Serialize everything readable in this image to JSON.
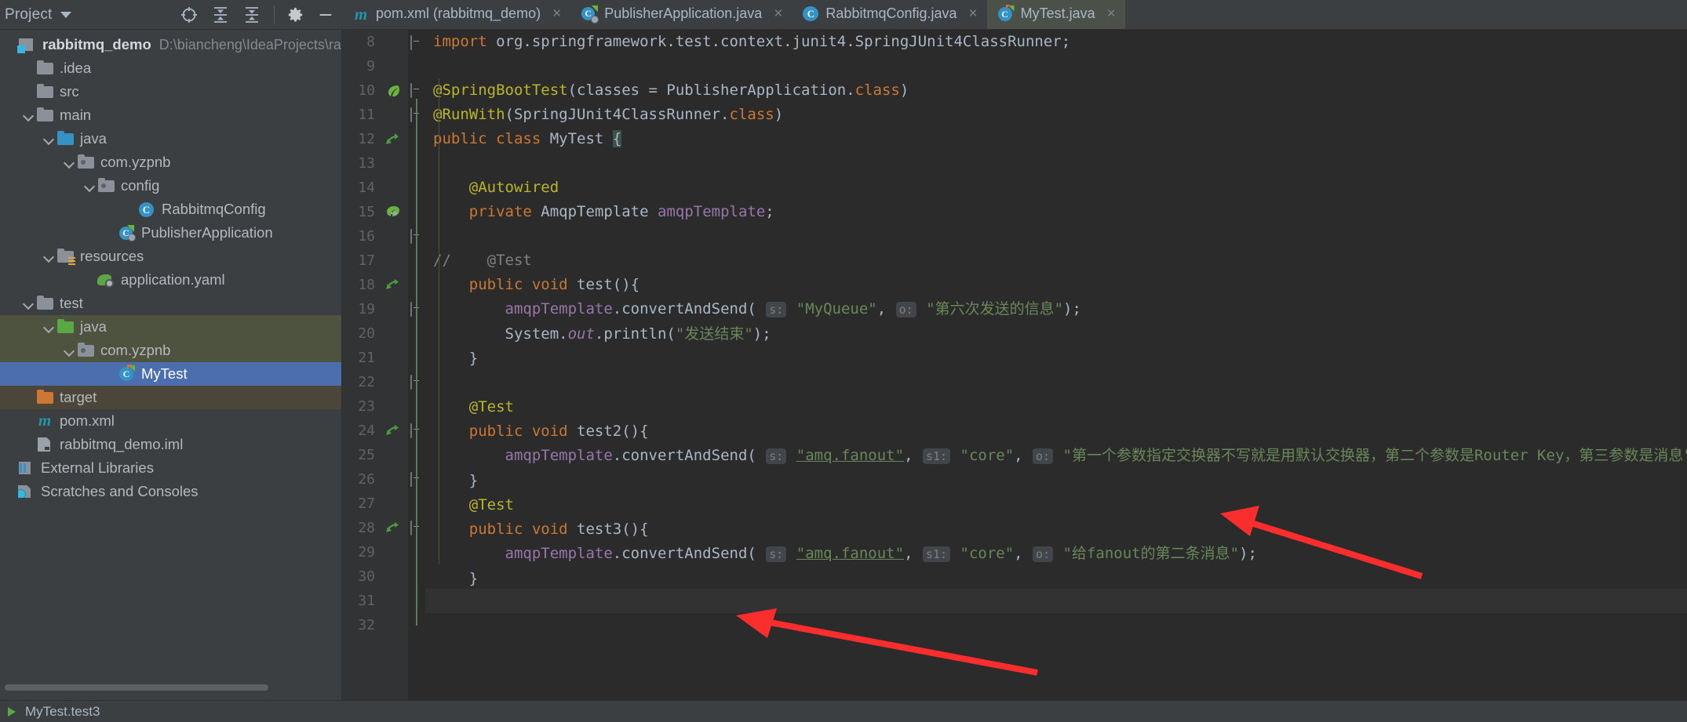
{
  "project_panel": {
    "title": "Project",
    "icons": [
      "locate-icon",
      "expand-all-icon",
      "collapse-all-icon",
      "gear-icon",
      "minimize-icon"
    ],
    "root": {
      "name": "rabbitmq_demo",
      "path": "D:\\biancheng\\IdeaProjects\\rab"
    },
    "items": [
      {
        "label": ".idea",
        "icon": "folder-icon",
        "indent": 1,
        "arrow": "none",
        "state": "normal"
      },
      {
        "label": "src",
        "icon": "folder-icon",
        "indent": 1,
        "arrow": "none",
        "state": "normal"
      },
      {
        "label": "main",
        "icon": "folder-icon",
        "indent": 2,
        "arrow": "open",
        "state": "normal"
      },
      {
        "label": "java",
        "icon": "source-folder-icon",
        "indent": 3,
        "arrow": "open",
        "state": "normal"
      },
      {
        "label": "com.yzpnb",
        "icon": "package-icon",
        "indent": 4,
        "arrow": "open",
        "state": "normal"
      },
      {
        "label": "config",
        "icon": "package-icon",
        "indent": 5,
        "arrow": "open",
        "state": "normal"
      },
      {
        "label": "RabbitmqConfig",
        "icon": "java-class-icon",
        "indent": 6,
        "arrow": "none",
        "state": "normal"
      },
      {
        "label": "PublisherApplication",
        "icon": "spring-boot-class-icon",
        "indent": 5,
        "arrow": "none",
        "state": "normal"
      },
      {
        "label": "resources",
        "icon": "resources-folder-icon",
        "indent": 3,
        "arrow": "open",
        "state": "normal"
      },
      {
        "label": "application.yaml",
        "icon": "spring-yaml-icon",
        "indent": 4,
        "arrow": "none",
        "state": "normal"
      },
      {
        "label": "test",
        "icon": "folder-icon",
        "indent": 2,
        "arrow": "open",
        "state": "normal"
      },
      {
        "label": "java",
        "icon": "test-source-folder-icon",
        "indent": 3,
        "arrow": "open",
        "state": "green"
      },
      {
        "label": "com.yzpnb",
        "icon": "package-icon",
        "indent": 4,
        "arrow": "open",
        "state": "green"
      },
      {
        "label": "MyTest",
        "icon": "java-test-class-icon",
        "indent": 5,
        "arrow": "none",
        "state": "selected"
      },
      {
        "label": "target",
        "icon": "excluded-folder-icon",
        "indent": 1,
        "arrow": "none",
        "state": "brown"
      },
      {
        "label": "pom.xml",
        "icon": "maven-icon",
        "indent": 1,
        "arrow": "none",
        "state": "normal"
      },
      {
        "label": "rabbitmq_demo.iml",
        "icon": "iml-file-icon",
        "indent": 1,
        "arrow": "none",
        "state": "normal"
      },
      {
        "label": "External Libraries",
        "icon": "library-icon",
        "indent": 0,
        "arrow": "none",
        "state": "normal"
      },
      {
        "label": "Scratches and Consoles",
        "icon": "scratches-icon",
        "indent": 0,
        "arrow": "none",
        "state": "normal"
      }
    ]
  },
  "tabs": [
    {
      "label": "pom.xml (rabbitmq_demo)",
      "icon": "maven-icon",
      "active": false,
      "close": "×"
    },
    {
      "label": "PublisherApplication.java",
      "icon": "spring-boot-class-icon",
      "active": false,
      "close": "×"
    },
    {
      "label": "RabbitmqConfig.java",
      "icon": "java-class-icon",
      "active": false,
      "close": "×"
    },
    {
      "label": "MyTest.java",
      "icon": "java-test-class-icon",
      "active": true,
      "close": "×"
    }
  ],
  "editor": {
    "first_line": 8,
    "last_line": 32,
    "caret_line": 31,
    "line_numbers": [
      8,
      9,
      10,
      11,
      12,
      13,
      14,
      15,
      16,
      17,
      18,
      19,
      20,
      21,
      22,
      23,
      24,
      25,
      26,
      27,
      28,
      29,
      30,
      31,
      32
    ],
    "gutter_marks": {
      "10": "spring-leaf-icon",
      "12": "implemented-method-icon",
      "15": "bean-autowired-icon",
      "18": "run-test-icon",
      "24": "run-test-icon",
      "28": "run-test-icon"
    },
    "lines": [
      {
        "n": 8,
        "text": "import org.springframework.test.context.junit4.SpringJUnit4ClassRunner;"
      },
      {
        "n": 9,
        "text": ""
      },
      {
        "n": 10,
        "text": "@SpringBootTest(classes = PublisherApplication.class)"
      },
      {
        "n": 11,
        "text": "@RunWith(SpringJUnit4ClassRunner.class)"
      },
      {
        "n": 12,
        "text": "public class MyTest {"
      },
      {
        "n": 13,
        "text": ""
      },
      {
        "n": 14,
        "text": "    @Autowired"
      },
      {
        "n": 15,
        "text": "    private AmqpTemplate amqpTemplate;"
      },
      {
        "n": 16,
        "text": ""
      },
      {
        "n": 17,
        "text": "//    @Test"
      },
      {
        "n": 18,
        "text": "    public void test(){"
      },
      {
        "n": 19,
        "text": "        amqpTemplate.convertAndSend( s: \"MyQueue\", o: \"第六次发送的信息\");"
      },
      {
        "n": 20,
        "text": "        System.out.println(\"发送结束\");"
      },
      {
        "n": 21,
        "text": "    }"
      },
      {
        "n": 22,
        "text": ""
      },
      {
        "n": 23,
        "text": "    @Test"
      },
      {
        "n": 24,
        "text": "    public void test2(){"
      },
      {
        "n": 25,
        "text": "        amqpTemplate.convertAndSend( s: \"amq.fanout\", s1: \"core\", o: \"第一个参数指定交换器不写就是用默认交换器，第二个参数是Router Key，第三参数是消息\");"
      },
      {
        "n": 26,
        "text": "    }"
      },
      {
        "n": 27,
        "text": "    @Test"
      },
      {
        "n": 28,
        "text": "    public void test3(){"
      },
      {
        "n": 29,
        "text": "        amqpTemplate.convertAndSend( s: \"amq.fanout\", s1: \"core\", o: \"给fanout的第二条消息\");"
      },
      {
        "n": 30,
        "text": "    }"
      },
      {
        "n": 31,
        "text": "}"
      },
      {
        "n": 32,
        "text": ""
      }
    ],
    "param_hints": [
      "s:",
      "o:",
      "s1:"
    ],
    "strings": [
      "\"MyQueue\"",
      "\"第六次发送的信息\"",
      "\"发送结束\"",
      "\"amq.fanout\"",
      "\"core\"",
      "\"给fanout的第二条消息\""
    ],
    "annotations": [
      "@SpringBootTest",
      "@RunWith",
      "@Autowired",
      "@Test"
    ]
  },
  "bottom_bar": {
    "label": "MyTest.test3"
  },
  "colors": {
    "background": "#2b2b2b",
    "panel": "#3c3f41",
    "selection_blue": "#4b6eaf",
    "keyword_orange": "#cc7832",
    "string_green": "#6a8759",
    "annotation_yellow": "#bbb529",
    "field_purple": "#9876aa",
    "text": "#a9b7c6",
    "arrow_red": "#fb2d2d"
  },
  "annotation_arrows": [
    {
      "name": "arrow-pointing-line-25",
      "color": "#fb2d2d"
    },
    {
      "name": "arrow-pointing-line-31",
      "color": "#fb2d2d"
    }
  ]
}
